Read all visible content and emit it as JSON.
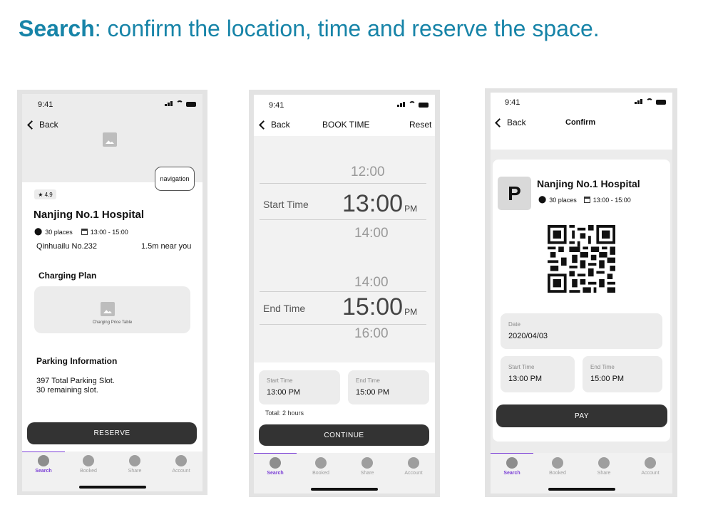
{
  "headline": {
    "keyword": "Search",
    "rest": ": confirm the location, time and reserve the space."
  },
  "status": {
    "time": "9:41"
  },
  "tabs": [
    "Search",
    "Booked",
    "Share",
    "Account"
  ],
  "screen1": {
    "back": "Back",
    "nav_button": "navigation",
    "rating": "★ 4.9",
    "name": "Nanjing No.1 Hospital",
    "places": "30 places",
    "hours": "13:00 - 15:00",
    "address": "Qinhuailu No.232",
    "distance": "1.5m near you",
    "charging_title": "Charging Plan",
    "charging_caption": "Charging Price Table",
    "parking_title": "Parking Information",
    "parking_total": "397 Total Parking Slot.",
    "parking_remaining": "30 remaining slot.",
    "reserve": "RESERVE"
  },
  "screen2": {
    "back": "Back",
    "title": "BOOK TIME",
    "reset": "Reset",
    "start_above": "12:00",
    "start_label": "Start Time",
    "start_value": "13:00",
    "start_ampm": "PM",
    "start_below": "14:00",
    "end_above": "14:00",
    "end_label": "End Time",
    "end_value": "15:00",
    "end_ampm": "PM",
    "end_below": "16:00",
    "start_box_label": "Start Time",
    "start_box_value": "13:00 PM",
    "end_box_label": "End Time",
    "end_box_value": "15:00 PM",
    "total": "Total: 2 hours",
    "continue": "CONTINUE"
  },
  "screen3": {
    "back": "Back",
    "title": "Confirm",
    "p_badge": "P",
    "name": "Nanjing No.1 Hospital",
    "places": "30 places",
    "hours": "13:00 - 15:00",
    "date_label": "Date",
    "date_value": "2020/04/03",
    "start_label": "Start Time",
    "start_value": "13:00 PM",
    "end_label": "End Time",
    "end_value": "15:00 PM",
    "pay": "PAY"
  }
}
